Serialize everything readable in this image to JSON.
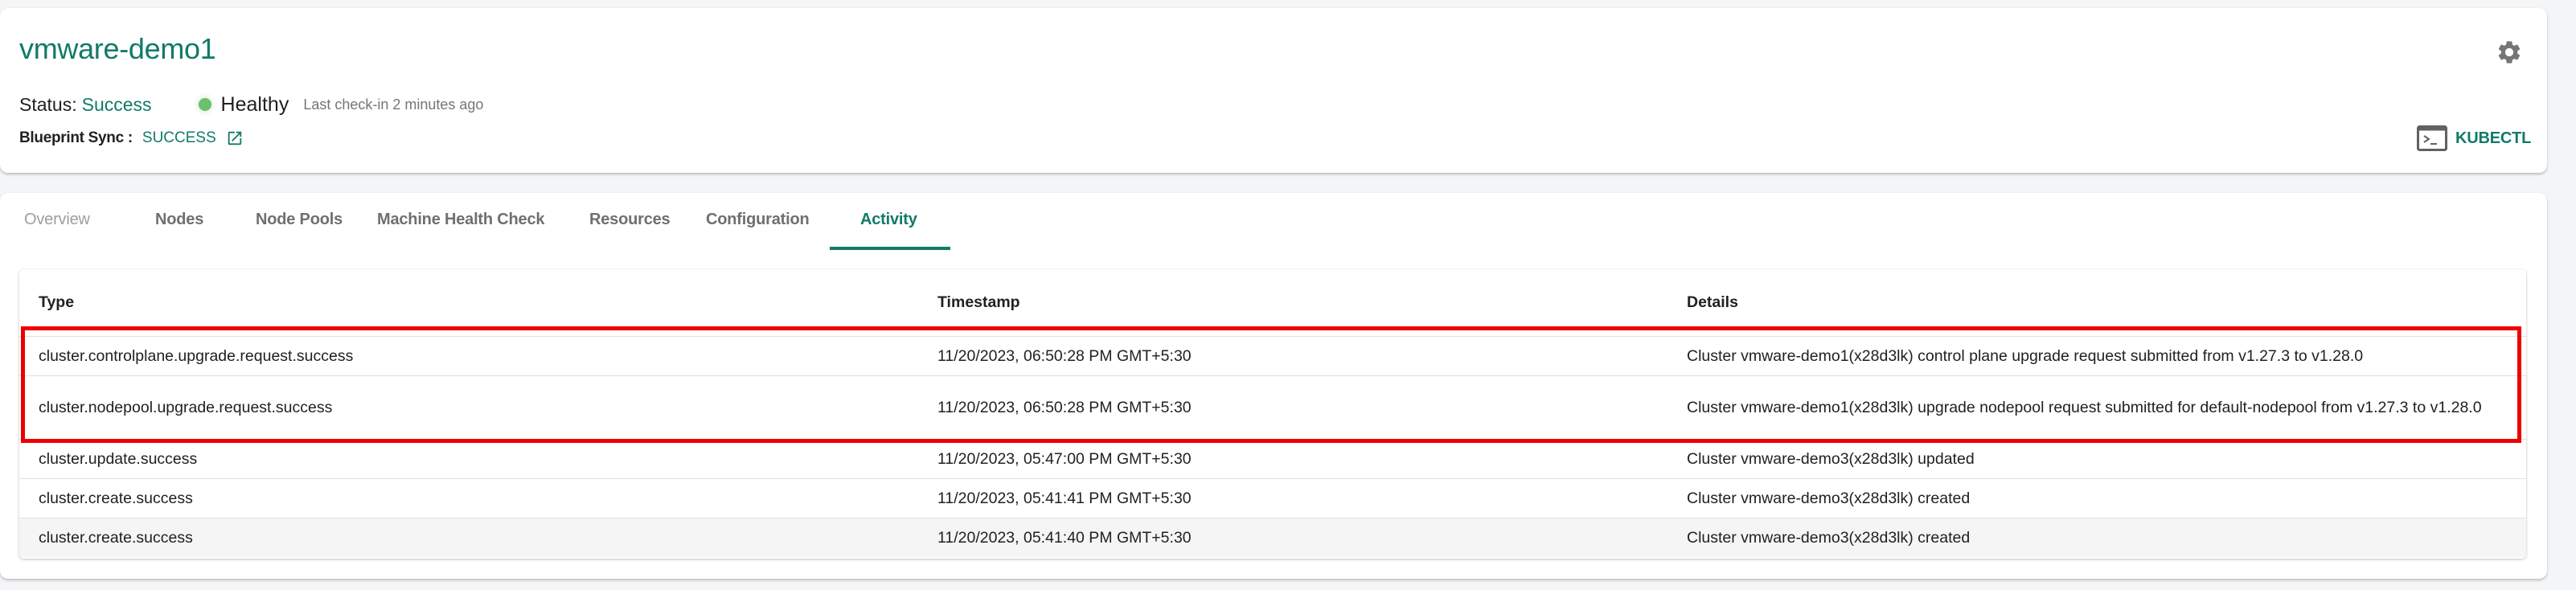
{
  "header": {
    "title": "vmware-demo1",
    "status_label": "Status:",
    "status_value": "Success",
    "health_label": "Healthy",
    "health_color": "#6cbf6c",
    "last_checkin": "Last check-in 2 minutes ago",
    "blueprint_label": "Blueprint Sync :",
    "blueprint_value": "SUCCESS",
    "blueprint_icon": "external-link-icon",
    "settings_icon": "gear-icon",
    "kubectl_icon": "terminal-icon",
    "kubectl_label": "KUBECTL"
  },
  "tabs": [
    {
      "label": "Overview",
      "state": "disabled"
    },
    {
      "label": "Nodes",
      "state": "normal"
    },
    {
      "label": "Node Pools",
      "state": "normal"
    },
    {
      "label": "Machine Health Check",
      "state": "normal"
    },
    {
      "label": "Resources",
      "state": "normal"
    },
    {
      "label": "Configuration",
      "state": "normal"
    },
    {
      "label": "Activity",
      "state": "active"
    }
  ],
  "activity_table": {
    "columns": [
      "Type",
      "Timestamp",
      "Details"
    ],
    "rows": [
      {
        "type": "cluster.controlplane.upgrade.request.success",
        "timestamp": "11/20/2023, 06:50:28 PM GMT+5:30",
        "details": "Cluster vmware-demo1(x28d3lk) control plane upgrade request submitted from v1.27.3 to v1.28.0",
        "highlighted": true
      },
      {
        "type": "cluster.nodepool.upgrade.request.success",
        "timestamp": "11/20/2023, 06:50:28 PM GMT+5:30",
        "details": "Cluster vmware-demo1(x28d3lk) upgrade nodepool request submitted for default-nodepool from v1.27.3 to v1.28.0",
        "highlighted": true
      },
      {
        "type": "cluster.update.success",
        "timestamp": "11/20/2023, 05:47:00 PM GMT+5:30",
        "details": "Cluster vmware-demo3(x28d3lk) updated",
        "highlighted": false
      },
      {
        "type": "cluster.create.success",
        "timestamp": "11/20/2023, 05:41:41 PM GMT+5:30",
        "details": "Cluster vmware-demo3(x28d3lk) created",
        "highlighted": false
      },
      {
        "type": "cluster.create.success",
        "timestamp": "11/20/2023, 05:41:40 PM GMT+5:30",
        "details": "Cluster vmware-demo3(x28d3lk) created",
        "highlighted": false
      }
    ]
  },
  "colors": {
    "accent": "#117a68",
    "highlight_border": "#ee0000",
    "background": "#f4f5f7",
    "icon_gray": "#757575"
  }
}
